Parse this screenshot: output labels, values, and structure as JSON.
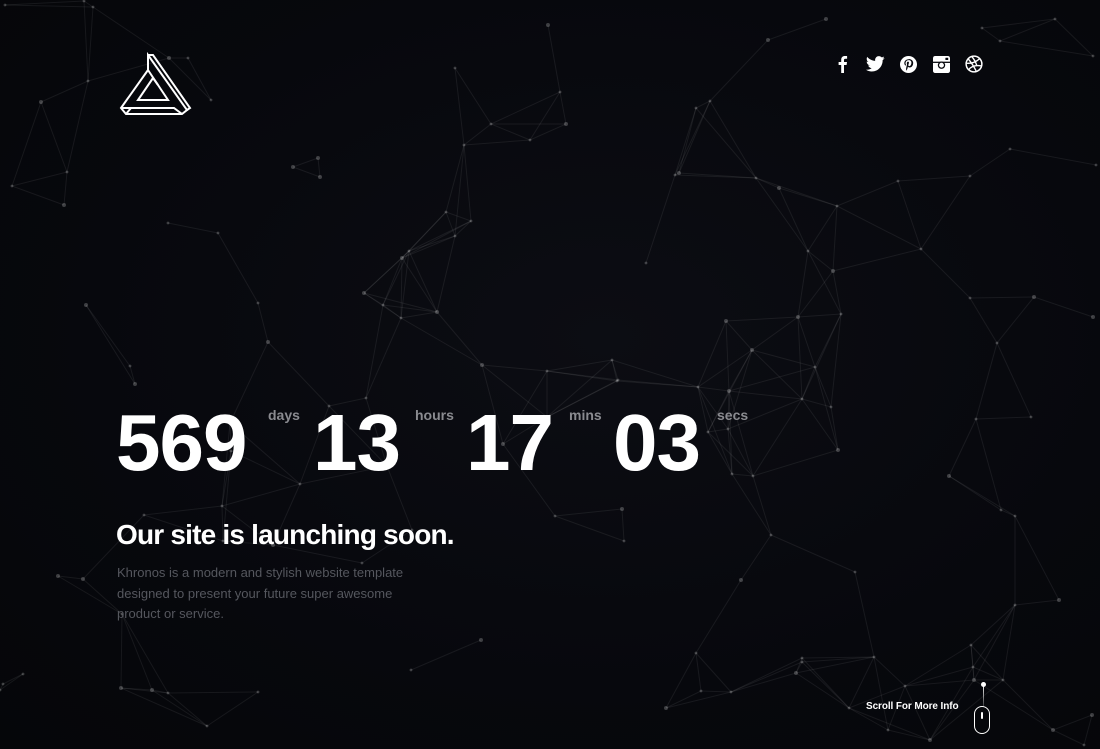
{
  "brand": {
    "logo_icon": "impossible-triangle-logo-icon"
  },
  "social": [
    {
      "name": "facebook-icon"
    },
    {
      "name": "twitter-icon"
    },
    {
      "name": "pinterest-icon"
    },
    {
      "name": "instagram-icon"
    },
    {
      "name": "dribbble-icon"
    }
  ],
  "countdown": {
    "days": {
      "value": "569",
      "label": "days"
    },
    "hours": {
      "value": "13",
      "label": "hours"
    },
    "mins": {
      "value": "17",
      "label": "mins"
    },
    "secs": {
      "value": "03",
      "label": "secs"
    }
  },
  "hero": {
    "headline": "Our site is launching soon.",
    "description": "Khronos is a modern and stylish website template designed to present your future super awesome product or service."
  },
  "scroll": {
    "label": "Scroll For More Info",
    "icon": "mouse-scroll-icon"
  },
  "colors": {
    "background": "#07080d",
    "text": "#ffffff",
    "muted_label": "#8a8b90",
    "muted_body": "#55575e",
    "network_line": "#23252b"
  }
}
